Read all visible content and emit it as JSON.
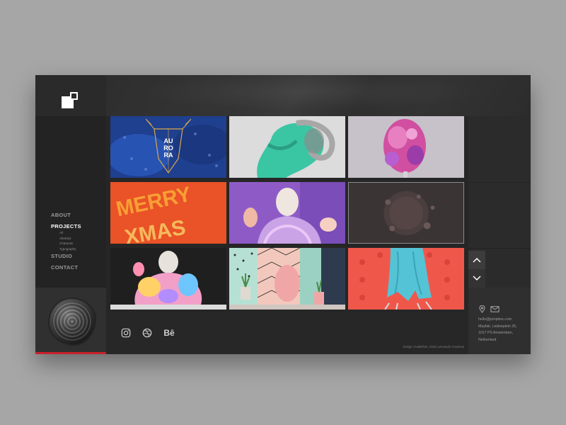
{
  "brand": {
    "logo": "square-logo-icon"
  },
  "nav": {
    "about": "ABOUT",
    "projects": "PROJECTS",
    "projects_sub": [
      "All",
      "Abstract",
      "Character",
      "Typography"
    ],
    "studio": "STUDIO",
    "contact": "CONTACT",
    "active": "PROJECTS"
  },
  "gallery": {
    "tiles": [
      {
        "name": "aurora-deer",
        "palette": [
          "#1f3f8f",
          "#c79a47"
        ],
        "text": "AU RO RA"
      },
      {
        "name": "teal-sculpture",
        "palette": [
          "#d9d9d9",
          "#3bc6a3"
        ]
      },
      {
        "name": "pink-abstract",
        "palette": [
          "#c7c0c8",
          "#d14fa0"
        ]
      },
      {
        "name": "merry-xmas",
        "palette": [
          "#e84a25",
          "#f7a234"
        ]
      },
      {
        "name": "purple-bust",
        "palette": [
          "#8f5cc7",
          "#e6b8a8"
        ]
      },
      {
        "name": "dark-sphere",
        "palette": [
          "#3a3434",
          "#5a4a4a"
        ]
      },
      {
        "name": "colorful-bust",
        "palette": [
          "#1f1f1f",
          "#f2a0c8"
        ]
      },
      {
        "name": "pattern-room",
        "palette": [
          "#9bd1c2",
          "#f0a6a6"
        ]
      },
      {
        "name": "blue-drape",
        "palette": [
          "#f0574b",
          "#55c3d6"
        ]
      }
    ],
    "prev_icon": "chevron-up-icon",
    "next_icon": "chevron-down-icon"
  },
  "contact": {
    "icons": [
      "location-pin-icon",
      "mail-icon"
    ],
    "lines": [
      "hello@jumpbox.com",
      "Mayfair, Leidseplein 25,",
      "1017 PS Amsterdam,",
      "Netherland"
    ]
  },
  "footer": {
    "social": [
      "instagram-icon",
      "dribbble-icon",
      "behance-icon"
    ],
    "behance_label": "Bē",
    "credit": "Design: mudleifrah, 2018 Lemonade Creatives"
  },
  "colors": {
    "accent": "#c8202a",
    "background": "#262626",
    "page": "#a6a6a6"
  }
}
